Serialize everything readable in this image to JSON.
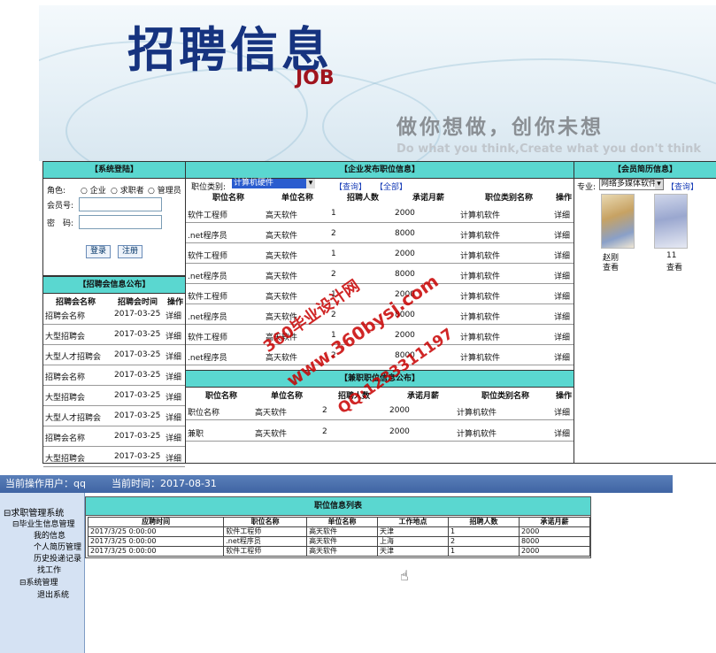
{
  "banner": {
    "title": "招聘信息",
    "job": "JOB",
    "slogan": "做你想做，创你未想",
    "slogan_en": "Do what you think,Create what you don't think"
  },
  "login": {
    "header": "【系统登陆】",
    "role_label": "角色:",
    "roles": [
      "企业",
      "求职者",
      "管理员"
    ],
    "member_label": "会员号:",
    "password_label": "密　码:",
    "login_button": "登录",
    "register_button": "注册"
  },
  "fairs": {
    "header": "【招聘会信息公布】",
    "columns": [
      "招聘会名称",
      "招聘会时间",
      "操作"
    ],
    "rows": [
      [
        "招聘会名称",
        "2017-03-25",
        "详细"
      ],
      [
        "大型招聘会",
        "2017-03-25",
        "详细"
      ],
      [
        "大型人才招聘会",
        "2017-03-25",
        "详细"
      ],
      [
        "招聘会名称",
        "2017-03-25",
        "详细"
      ],
      [
        "大型招聘会",
        "2017-03-25",
        "详细"
      ],
      [
        "大型人才招聘会",
        "2017-03-25",
        "详细"
      ],
      [
        "招聘会名称",
        "2017-03-25",
        "详细"
      ],
      [
        "大型招聘会",
        "2017-03-25",
        "详细"
      ]
    ]
  },
  "jobs": {
    "header": "【企业发布职位信息】",
    "category_label": "职位类别:",
    "category_value": "计算机硬件",
    "query_link": "【查询】",
    "all_link": "【全部】",
    "columns": [
      "职位名称",
      "单位名称",
      "招聘人数",
      "承诺月薪",
      "职位类别名称",
      "操作"
    ],
    "rows": [
      [
        "软件工程师",
        "高天软件",
        "1",
        "2000",
        "计算机软件",
        "详细"
      ],
      [
        ".net程序员",
        "高天软件",
        "2",
        "8000",
        "计算机软件",
        "详细"
      ],
      [
        "软件工程师",
        "高天软件",
        "1",
        "2000",
        "计算机软件",
        "详细"
      ],
      [
        ".net程序员",
        "高天软件",
        "2",
        "8000",
        "计算机软件",
        "详细"
      ],
      [
        "软件工程师",
        "高天软件",
        "1",
        "2000",
        "计算机软件",
        "详细"
      ],
      [
        ".net程序员",
        "高天软件",
        "2",
        "8000",
        "计算机软件",
        "详细"
      ],
      [
        "软件工程师",
        "高天软件",
        "1",
        "2000",
        "计算机软件",
        "详细"
      ],
      [
        ".net程序员",
        "高天软件",
        "2",
        "8000",
        "计算机软件",
        "详细"
      ]
    ]
  },
  "parttime": {
    "header": "【兼职职位信息公布】",
    "columns": [
      "职位名称",
      "单位名称",
      "招聘人数",
      "承诺月薪",
      "职位类别名称",
      "操作"
    ],
    "rows": [
      [
        "职位名称",
        "高天软件",
        "2",
        "2000",
        "计算机软件",
        "详细"
      ],
      [
        "兼职",
        "高天软件",
        "2",
        "2000",
        "计算机软件",
        "详细"
      ]
    ]
  },
  "resumes": {
    "header": "【会员简历信息】",
    "major_label": "专业:",
    "major_value": "网络多媒体软件",
    "query_link": "【查询】",
    "members": [
      {
        "name": "赵刚",
        "action": "查看"
      },
      {
        "name": "11",
        "action": "查看"
      }
    ]
  },
  "watermark": {
    "line1": "360毕业设计网",
    "line2": "www.360bysj.com",
    "line3": "QQ:1233311197"
  },
  "admin": {
    "current_user": "当前操作用户：qq",
    "current_time": "当前时间：2017-08-31",
    "tree": {
      "root": "求职管理系统",
      "group1": "毕业生信息管理",
      "items1": [
        "我的信息",
        "个人简历管理",
        "历史投递记录",
        "找工作"
      ],
      "group2": "系统管理",
      "items2": [
        "退出系统"
      ]
    },
    "list": {
      "header": "职位信息列表",
      "columns": [
        "应聘时间",
        "职位名称",
        "单位名称",
        "工作地点",
        "招聘人数",
        "承诺月薪"
      ],
      "rows": [
        [
          "2017/3/25 0:00:00",
          "软件工程师",
          "高天软件",
          "天津",
          "1",
          "2000"
        ],
        [
          "2017/3/25 0:00:00",
          ".net程序员",
          "高天软件",
          "上海",
          "2",
          "8000"
        ],
        [
          "2017/3/25 0:00:00",
          "软件工程师",
          "高天软件",
          "天津",
          "1",
          "2000"
        ]
      ]
    }
  }
}
